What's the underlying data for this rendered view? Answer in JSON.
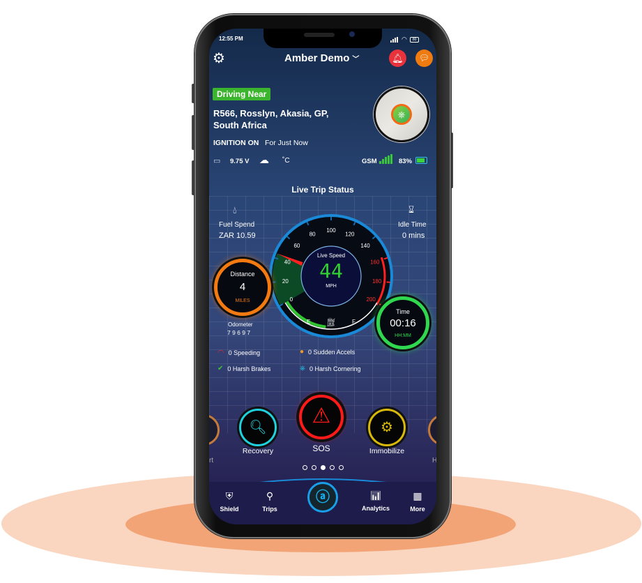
{
  "status_bar": {
    "time": "12:55 PM",
    "battery": "80"
  },
  "header": {
    "title": "Amber Demo",
    "settings_icon": "gear-icon",
    "alert_icon": "bell-icon",
    "chat_icon": "chat-icon",
    "alert_color": "#e8323c",
    "chat_color": "#ee7a10"
  },
  "location": {
    "status": "Driving Near",
    "address_line1": "R566, Rosslyn, Akasia, GP,",
    "address_line2": "South Africa",
    "ignition": "IGNITION ON",
    "ignition_since": "For Just Now",
    "status_color": "#3cb52e"
  },
  "vitals": {
    "voltage": "9.75 V",
    "temperature": "˚C",
    "gsm_label": "GSM",
    "battery": "83%"
  },
  "trip": {
    "title": "Live Trip Status",
    "fuel_label": "Fuel Spend",
    "fuel_value": "ZAR 10.59",
    "idle_label": "Idle Time",
    "idle_value": "0 mins",
    "distance_label": "Distance",
    "distance_value": "4",
    "distance_unit": "MILES",
    "odometer_label": "Odometer",
    "odometer_value": "7 9 6 9 7",
    "time_label": "Time",
    "time_value": "00:16",
    "time_unit": "HH:MM",
    "speed_label": "Live Speed",
    "speed_value": "44",
    "speed_unit": "MPH",
    "speed": 44,
    "speed_max": 200,
    "speed_ticks": [
      "0",
      "20",
      "40",
      "60",
      "80",
      "100",
      "120",
      "140",
      "160",
      "180",
      "200"
    ],
    "fuel_e": "E",
    "fuel_f": "F",
    "fuel_level": 0.45
  },
  "events": [
    {
      "label": "0 Speeding",
      "icon": "speedometer-icon",
      "color": "#e52525"
    },
    {
      "label": "0 Sudden Accels",
      "icon": "acceleration-icon",
      "color": "#f39a1e"
    },
    {
      "label": "0 Harsh Brakes",
      "icon": "brake-icon",
      "color": "#3cc43c"
    },
    {
      "label": "0  Harsh Cornering",
      "icon": "steering-icon",
      "color": "#1fc8e8"
    }
  ],
  "actions": [
    {
      "label": "rt"
    },
    {
      "label": "Recovery",
      "color": "#1fd0dd"
    },
    {
      "label": "SOS",
      "color": "#ff1a1a"
    },
    {
      "label": "Immobilize",
      "color": "#d8b80a"
    },
    {
      "label": "H"
    }
  ],
  "pager": {
    "count": 5,
    "active": 2
  },
  "nav": [
    {
      "label": "Shield"
    },
    {
      "label": "Trips"
    },
    {
      "label": "Analytics"
    },
    {
      "label": "More"
    }
  ]
}
